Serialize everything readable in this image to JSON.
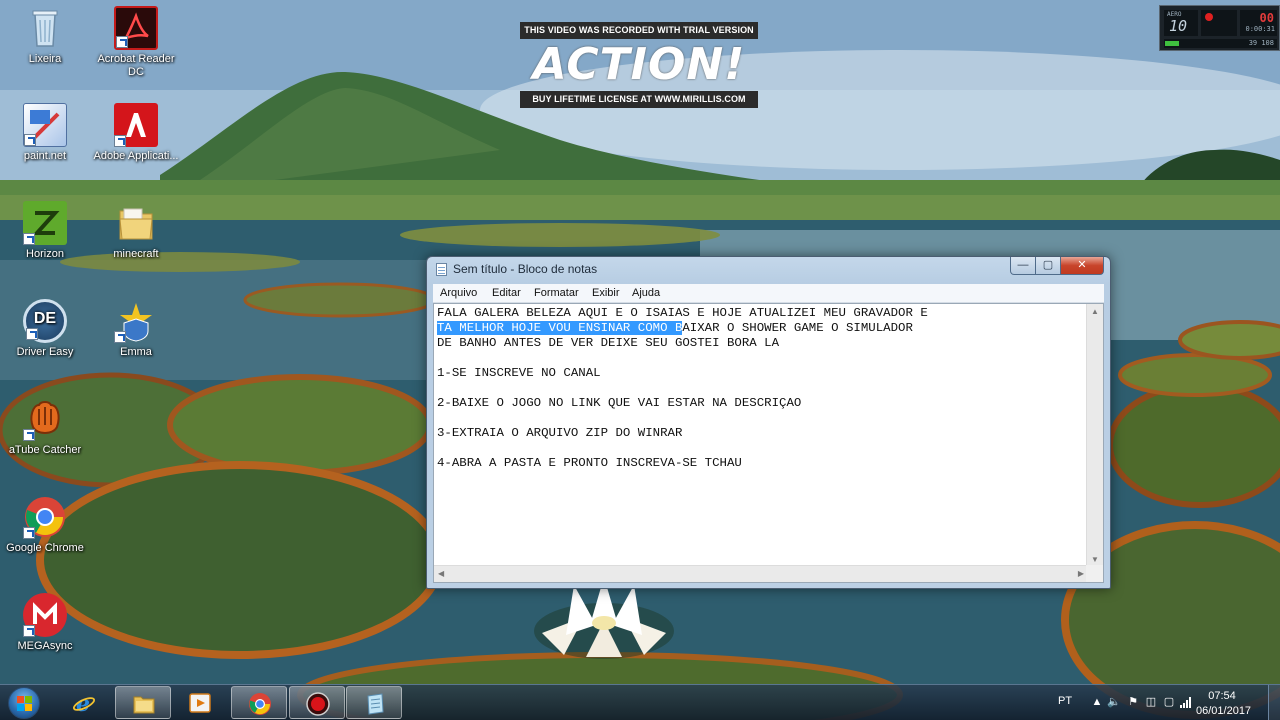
{
  "watermark": {
    "top_text": "THIS VIDEO WAS RECORDED WITH TRIAL VERSION",
    "logo_text": "ACTION!",
    "bottom_text": "BUY LIFETIME LICENSE AT WWW.MIRILLIS.COM"
  },
  "recorder": {
    "mode_label": "AERO",
    "mode_value": "10",
    "rec_indicator": "00",
    "timer": "0:00:31",
    "size": "39 108"
  },
  "desktop_icons": [
    {
      "label": "Lixeira",
      "icon": "recycle-bin-icon"
    },
    {
      "label": "Acrobat Reader DC",
      "icon": "acrobat-reader-icon"
    },
    {
      "label": "paint.net",
      "icon": "paint-net-icon"
    },
    {
      "label": "Adobe Applicati...",
      "icon": "adobe-application-icon"
    },
    {
      "label": "Horizon",
      "icon": "horizon-icon"
    },
    {
      "label": "minecraft",
      "icon": "folder-icon"
    },
    {
      "label": "Driver Easy",
      "icon": "driver-easy-icon"
    },
    {
      "label": "Emma",
      "icon": "emma-icon"
    },
    {
      "label": "aTube Catcher",
      "icon": "atube-catcher-icon"
    },
    {
      "label": "Google Chrome",
      "icon": "chrome-icon"
    },
    {
      "label": "MEGAsync",
      "icon": "megasync-icon"
    }
  ],
  "notepad": {
    "title": "Sem título - Bloco de notas",
    "menu": [
      "Arquivo",
      "Editar",
      "Formatar",
      "Exibir",
      "Ajuda"
    ],
    "line1": "FALA GALERA BELEZA AQUI E O ISAIAS E HOJE ATUALIZEI MEU GRAVADOR E",
    "line2_selected": "TA MELHOR HOJE VOU ENSINAR COMO B",
    "line2_rest": "AIXAR O SHOWER GAME O SIMULADOR",
    "line3": "DE BANHO ANTES DE VER DEIXE SEU GOSTEI BORA LA",
    "line4": "",
    "line5": "1-SE INSCREVE NO CANAL",
    "line6": "",
    "line7": "2-BAIXE O JOGO NO LINK QUE VAI ESTAR NA DESCRIÇAO",
    "line8": "",
    "line9": "3-EXTRAIA O ARQUIVO ZIP DO WINRAR",
    "line10": "",
    "line11": "4-ABRA A PASTA E PRONTO INSCREVA-SE TCHAU"
  },
  "taskbar": {
    "apps": [
      {
        "name": "internet-explorer-icon",
        "active": false
      },
      {
        "name": "file-explorer-icon",
        "active": true
      },
      {
        "name": "media-player-icon",
        "active": false
      },
      {
        "name": "chrome-icon",
        "active": true
      },
      {
        "name": "action-recorder-icon",
        "active": true
      },
      {
        "name": "notepad-icon",
        "active": true
      }
    ],
    "language": "PT",
    "time": "07:54",
    "date": "06/01/2017"
  },
  "colors": {
    "selection": "#3399ff",
    "close_button": "#c8442b",
    "taskbar": "#1a2b3d"
  }
}
